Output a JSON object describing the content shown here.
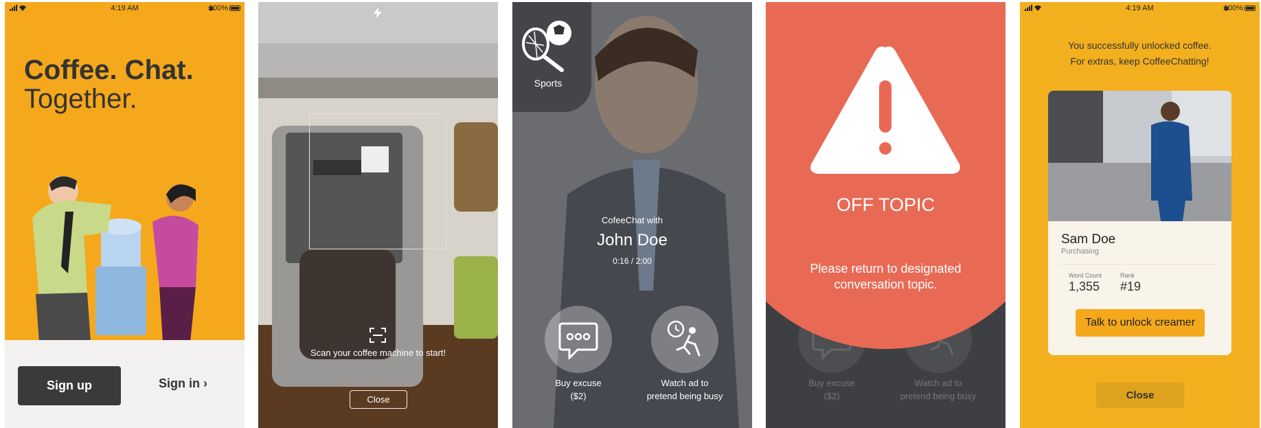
{
  "status_bar": {
    "time": "4:19 AM",
    "battery": "100%"
  },
  "screen1": {
    "headline_bold": "Coffee. Chat.",
    "headline_regular": "Together.",
    "signup_label": "Sign up",
    "signin_label": "Sign in ›"
  },
  "screen2": {
    "scan_text": "Scan your coffee machine to start!",
    "close_label": "Close"
  },
  "screen3": {
    "topic": "Sports",
    "with_label": "CofeeChat with",
    "name": "John Doe",
    "timer": "0:16 / 2:00",
    "excuse_line1": "Buy excuse",
    "excuse_line2": "($2)",
    "ad_line1": "Watch ad to",
    "ad_line2": "pretend being busy"
  },
  "screen4": {
    "title": "OFF TOPIC",
    "message_line1": "Please return to designated",
    "message_line2": "conversation topic.",
    "excuse_line1": "Buy excuse",
    "excuse_line2": "($2)",
    "ad_line1": "Watch ad to",
    "ad_line2": "pretend being busy"
  },
  "screen5": {
    "message_line1": "You successfully unlocked coffee.",
    "message_line2": "For extras, keep CoffeeChatting!",
    "name": "Sam Doe",
    "role": "Purchasing",
    "word_count_label": "Word Count",
    "word_count_value": "1,355",
    "rank_label": "Rank",
    "rank_value": "#19",
    "cta_label": "Talk to unlock creamer",
    "close_label": "Close"
  },
  "colors": {
    "brand_yellow": "#f5a81c",
    "dark": "#3a3a3a",
    "alert_red": "#e86a55"
  }
}
